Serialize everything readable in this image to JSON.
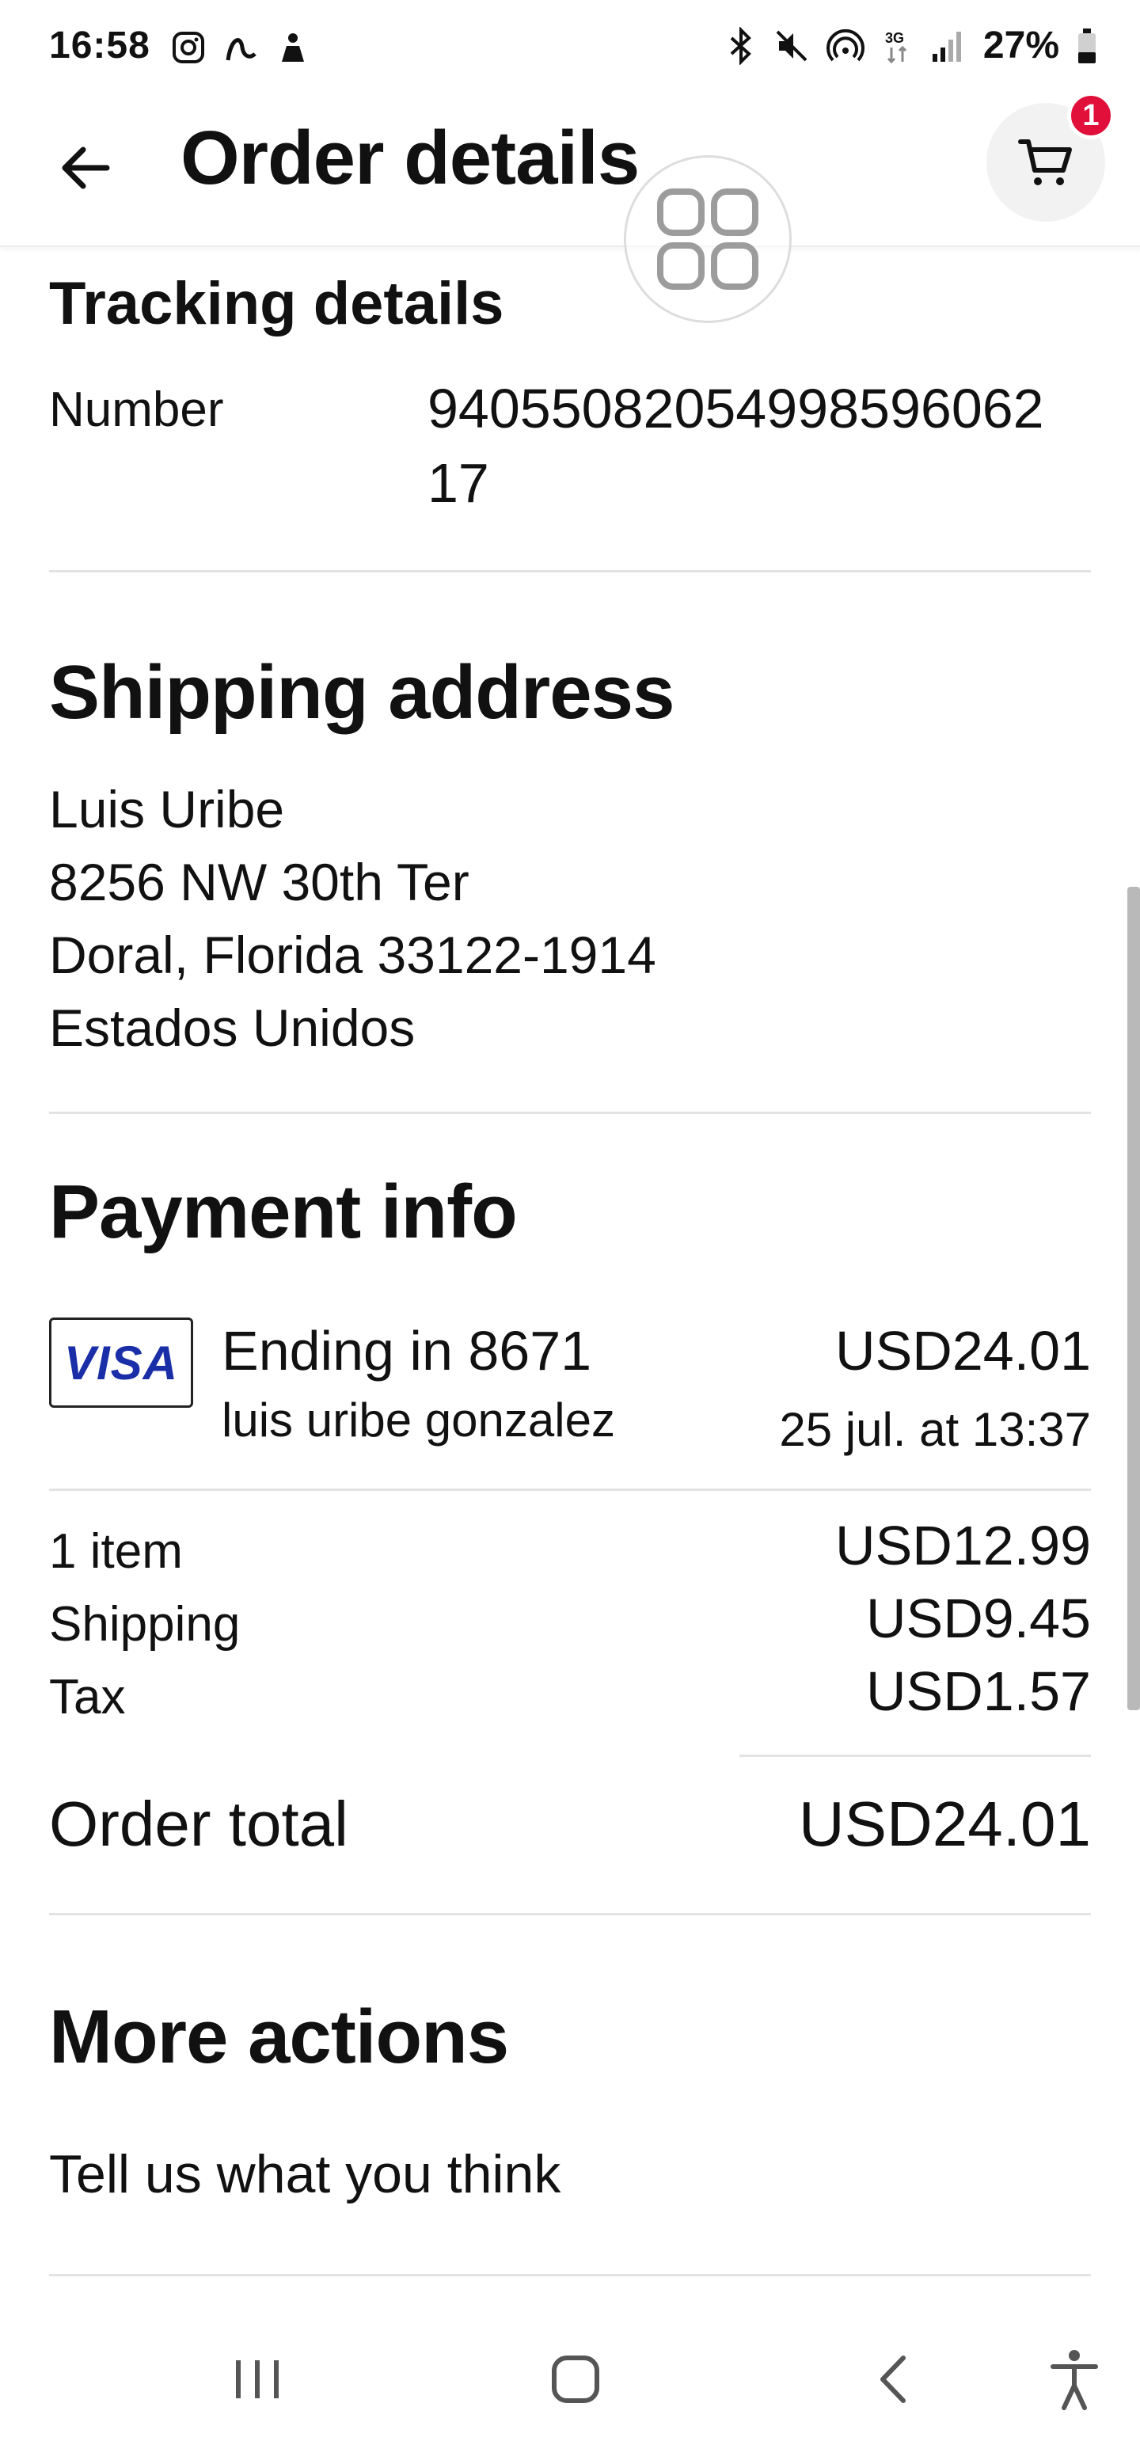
{
  "status_bar": {
    "time": "16:58",
    "left_icons": [
      "instagram-icon",
      "threads-icon",
      "notification-icon"
    ],
    "right_icons": [
      "bluetooth-icon",
      "mute-icon",
      "hotspot-icon",
      "network-3g-icon",
      "signal-icon"
    ],
    "battery": "27%"
  },
  "header": {
    "title": "Order details",
    "cart_count": "1"
  },
  "tracking": {
    "heading": "Tracking details",
    "number_label": "Number",
    "number_line1": "94055082054998596062",
    "number_line2": "17"
  },
  "shipping": {
    "heading": "Shipping address",
    "name": "Luis Uribe",
    "street": "8256 NW 30th Ter",
    "city": "Doral, Florida 33122-1914",
    "country": "Estados Unidos"
  },
  "payment": {
    "heading": "Payment info",
    "card_brand": "VISA",
    "card_ending": "Ending in 8671",
    "cardholder": "luis uribe gonzalez",
    "amount": "USD24.01",
    "date": "25 jul. at 13:37"
  },
  "summary": {
    "rows": [
      {
        "label": "1 item",
        "value": "USD12.99"
      },
      {
        "label": "Shipping",
        "value": "USD9.45"
      },
      {
        "label": "Tax",
        "value": "USD1.57"
      }
    ],
    "total_label": "Order total",
    "total_value": "USD24.01"
  },
  "more_actions": {
    "heading": "More actions",
    "feedback": "Tell us what you think"
  },
  "colors": {
    "badge": "#e0103a",
    "visa": "#1a2ea8",
    "text": "#111111",
    "divider": "#e3e3e3"
  }
}
